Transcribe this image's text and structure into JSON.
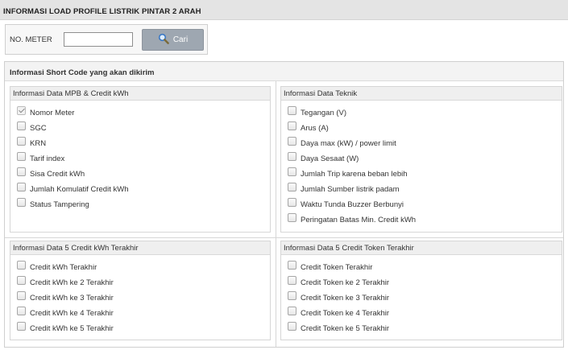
{
  "header": {
    "title": "INFORMASI LOAD PROFILE LISTRIK PINTAR 2 ARAH"
  },
  "search": {
    "label": "NO. METER",
    "value": "",
    "placeholder": "",
    "button_label": "Cari",
    "button_icon": "magnifier-icon"
  },
  "panel": {
    "title": "Informasi Short Code yang akan dikirim"
  },
  "sections": {
    "mpb": {
      "title": "Informasi Data MPB & Credit kWh",
      "items": [
        {
          "label": "Nomor Meter",
          "checked": true
        },
        {
          "label": "SGC",
          "checked": false
        },
        {
          "label": "KRN",
          "checked": false
        },
        {
          "label": "Tarif index",
          "checked": false
        },
        {
          "label": "Sisa Credit kWh",
          "checked": false
        },
        {
          "label": "Jumlah Komulatif Credit kWh",
          "checked": false
        },
        {
          "label": "Status Tampering",
          "checked": false
        }
      ]
    },
    "teknik": {
      "title": "Informasi Data Teknik",
      "items": [
        {
          "label": "Tegangan (V)",
          "checked": false
        },
        {
          "label": "Arus (A)",
          "checked": false
        },
        {
          "label": "Daya max (kW) / power limit",
          "checked": false
        },
        {
          "label": "Daya Sesaat (W)",
          "checked": false
        },
        {
          "label": "Jumlah Trip karena beban lebih",
          "checked": false
        },
        {
          "label": "Jumlah Sumber listrik padam",
          "checked": false
        },
        {
          "label": "Waktu Tunda Buzzer Berbunyi",
          "checked": false
        },
        {
          "label": "Peringatan Batas Min. Credit kWh",
          "checked": false
        }
      ]
    },
    "credit_kwh": {
      "title": "Informasi Data 5 Credit kWh Terakhir",
      "items": [
        {
          "label": "Credit kWh Terakhir",
          "checked": false
        },
        {
          "label": "Credit kWh ke 2 Terakhir",
          "checked": false
        },
        {
          "label": "Credit kWh ke 3 Terakhir",
          "checked": false
        },
        {
          "label": "Credit kWh ke 4 Terakhir",
          "checked": false
        },
        {
          "label": "Credit kWh ke 5 Terakhir",
          "checked": false
        }
      ]
    },
    "credit_token": {
      "title": "Informasi Data 5 Credit Token Terakhir",
      "items": [
        {
          "label": "Credit Token Terakhir",
          "checked": false
        },
        {
          "label": "Credit Token ke 2 Terakhir",
          "checked": false
        },
        {
          "label": "Credit Token ke 3 Terakhir",
          "checked": false
        },
        {
          "label": "Credit Token ke 4 Terakhir",
          "checked": false
        },
        {
          "label": "Credit Token ke 5 Terakhir",
          "checked": false
        }
      ]
    }
  }
}
